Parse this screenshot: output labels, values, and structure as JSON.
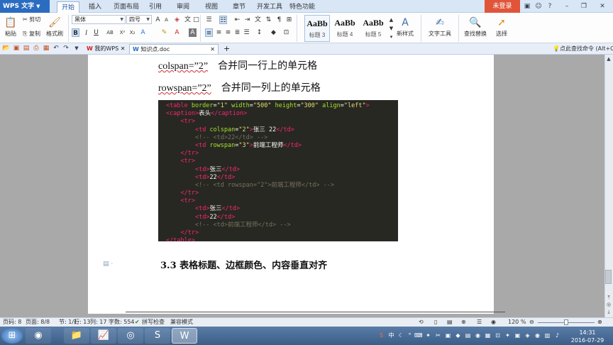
{
  "app": {
    "name": "WPS 文字",
    "login": "未登录"
  },
  "menu": [
    "开始",
    "插入",
    "页面布局",
    "引用",
    "审阅",
    "视图",
    "章节",
    "开发工具",
    "特色功能"
  ],
  "ribbon": {
    "paste": "粘贴",
    "cut": "剪切",
    "copy": "复制",
    "format_painter": "格式刷",
    "font_name": "黑体",
    "font_size": "四号",
    "styles": [
      {
        "sample": "AaBb",
        "label": "标题 3"
      },
      {
        "sample": "AaBb",
        "label": "标题 4"
      },
      {
        "sample": "AaBb",
        "label": "标题 5"
      }
    ],
    "new_style": "新样式",
    "text_tools": "文字工具",
    "find_replace": "查找替换",
    "select": "选择"
  },
  "tabs": [
    {
      "label": "我的WPS"
    },
    {
      "label": "知识点.doc"
    }
  ],
  "search_hint": "点此查找命令 (Alt+Q)",
  "document": {
    "line1": {
      "code": "colspan=”2”",
      "text": "合并同一行上的单元格"
    },
    "line2": {
      "code": "rowspan=”2”",
      "text": "合并同一列上的单元格"
    },
    "code_lines": [
      [
        [
          "t",
          "<table "
        ],
        [
          "a",
          "border"
        ],
        [
          "p",
          "="
        ],
        [
          "s",
          "\"1\""
        ],
        [
          "p",
          " "
        ],
        [
          "a",
          "width"
        ],
        [
          "p",
          "="
        ],
        [
          "s",
          "\"500\""
        ],
        [
          "p",
          " "
        ],
        [
          "a",
          "height"
        ],
        [
          "p",
          "="
        ],
        [
          "s",
          "\"300\""
        ],
        [
          "p",
          " "
        ],
        [
          "a",
          "align"
        ],
        [
          "p",
          "="
        ],
        [
          "s",
          "\"left\""
        ],
        [
          "t",
          ">"
        ]
      ],
      [
        [
          "t",
          "<caption>"
        ],
        [
          "p",
          "表头"
        ],
        [
          "t",
          "</caption>"
        ]
      ],
      [
        [
          "p",
          "    "
        ],
        [
          "t",
          "<tr>"
        ]
      ],
      [
        [
          "p",
          "        "
        ],
        [
          "t",
          "<td "
        ],
        [
          "a",
          "colspan"
        ],
        [
          "p",
          "="
        ],
        [
          "s",
          "\"2\""
        ],
        [
          "t",
          ">"
        ],
        [
          "p",
          "张三 22"
        ],
        [
          "t",
          "</td>"
        ]
      ],
      [
        [
          "p",
          "        "
        ],
        [
          "c",
          "<!-- <td>22</td> -->"
        ]
      ],
      [
        [
          "p",
          "        "
        ],
        [
          "t",
          "<td "
        ],
        [
          "a",
          "rowspan"
        ],
        [
          "p",
          "="
        ],
        [
          "s",
          "\"3\""
        ],
        [
          "t",
          ">"
        ],
        [
          "p",
          "前端工程师"
        ],
        [
          "t",
          "</td>"
        ]
      ],
      [
        [
          "p",
          "    "
        ],
        [
          "t",
          "</tr>"
        ]
      ],
      [
        [
          "p",
          "    "
        ],
        [
          "t",
          "<tr>"
        ]
      ],
      [
        [
          "p",
          "        "
        ],
        [
          "t",
          "<td>"
        ],
        [
          "p",
          "张三"
        ],
        [
          "t",
          "</td>"
        ]
      ],
      [
        [
          "p",
          "        "
        ],
        [
          "t",
          "<td>"
        ],
        [
          "p",
          "22"
        ],
        [
          "t",
          "</td>"
        ]
      ],
      [
        [
          "p",
          "        "
        ],
        [
          "c",
          "<!-- <td rowspan=\"2\">前端工程师</td> -->"
        ]
      ],
      [
        [
          "p",
          "    "
        ],
        [
          "t",
          "</tr>"
        ]
      ],
      [
        [
          "p",
          "    "
        ],
        [
          "t",
          "<tr>"
        ]
      ],
      [
        [
          "p",
          "        "
        ],
        [
          "t",
          "<td>"
        ],
        [
          "p",
          "张三"
        ],
        [
          "t",
          "</td>"
        ]
      ],
      [
        [
          "p",
          "        "
        ],
        [
          "t",
          "<td>"
        ],
        [
          "p",
          "22"
        ],
        [
          "t",
          "</td>"
        ]
      ],
      [
        [
          "p",
          "        "
        ],
        [
          "c",
          "<!-- <td>前端工程师</td> -->"
        ]
      ],
      [
        [
          "p",
          "    "
        ],
        [
          "t",
          "</tr>"
        ]
      ],
      [
        [
          "t",
          "</table>"
        ]
      ]
    ],
    "heading": "3.3  表格标题、边框颜色、内容垂直对齐"
  },
  "status": {
    "page_no": "页码: 8",
    "pages": "页面: 8/8",
    "section": "节: 1/1",
    "row": "行: 13",
    "col": "列: 17",
    "words": "字数: 554",
    "spell": "拼写检查",
    "compat": "兼容模式",
    "zoom": "120 %"
  },
  "clock": {
    "time": "14:31",
    "date": "2016-07-29"
  },
  "colors": {
    "accent": "#2a6cc0",
    "login": "#e0553a",
    "code_bg": "#272822"
  }
}
